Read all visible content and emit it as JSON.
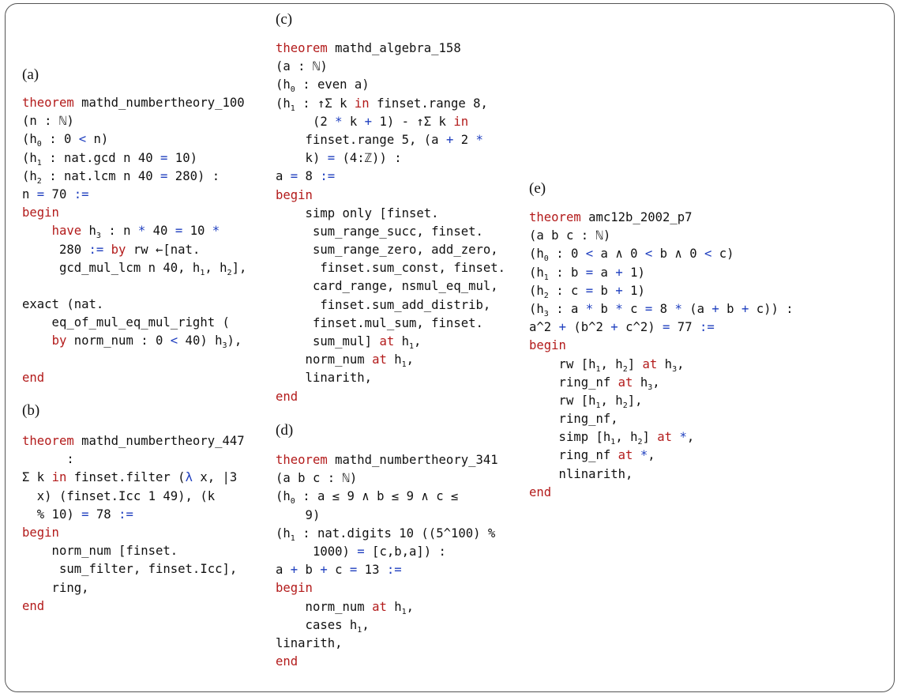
{
  "panels": [
    {
      "label": "(a)",
      "lines": [
        [
          [
            "kw",
            "theorem"
          ],
          [
            "t",
            " mathd_numbertheory_100"
          ]
        ],
        [
          [
            "t",
            "(n : ℕ)"
          ]
        ],
        [
          [
            "t",
            "(h"
          ],
          [
            "s",
            "0"
          ],
          [
            "t",
            " : 0 "
          ],
          [
            "op",
            "<"
          ],
          [
            "t",
            " n)"
          ]
        ],
        [
          [
            "t",
            "(h"
          ],
          [
            "s",
            "1"
          ],
          [
            "t",
            " : nat.gcd n 40 "
          ],
          [
            "op",
            "="
          ],
          [
            "t",
            " 10)"
          ]
        ],
        [
          [
            "t",
            "(h"
          ],
          [
            "s",
            "2"
          ],
          [
            "t",
            " : nat.lcm n 40 "
          ],
          [
            "op",
            "="
          ],
          [
            "t",
            " 280) :"
          ]
        ],
        [
          [
            "t",
            "n "
          ],
          [
            "op",
            "="
          ],
          [
            "t",
            " 70 "
          ],
          [
            "op",
            ":="
          ]
        ],
        [
          [
            "kw",
            "begin"
          ]
        ],
        [
          [
            "t",
            "    "
          ],
          [
            "kw",
            "have"
          ],
          [
            "t",
            " h"
          ],
          [
            "s",
            "3"
          ],
          [
            "t",
            " : n "
          ],
          [
            "op",
            "*"
          ],
          [
            "t",
            " 40 "
          ],
          [
            "op",
            "="
          ],
          [
            "t",
            " 10 "
          ],
          [
            "op",
            "*"
          ]
        ],
        [
          [
            "t",
            "     280 "
          ],
          [
            "op",
            ":="
          ],
          [
            "t",
            " "
          ],
          [
            "kw",
            "by"
          ],
          [
            "t",
            " rw ←[nat."
          ]
        ],
        [
          [
            "t",
            "     gcd_mul_lcm n 40, h"
          ],
          [
            "s",
            "1"
          ],
          [
            "t",
            ", h"
          ],
          [
            "s",
            "2"
          ],
          [
            "t",
            "],"
          ]
        ],
        [],
        [
          [
            "t",
            "exact (nat."
          ]
        ],
        [
          [
            "t",
            "    eq_of_mul_eq_mul_right ("
          ]
        ],
        [
          [
            "t",
            "    "
          ],
          [
            "kw",
            "by"
          ],
          [
            "t",
            " norm_num : 0 "
          ],
          [
            "op",
            "<"
          ],
          [
            "t",
            " 40) h"
          ],
          [
            "s",
            "3"
          ],
          [
            "t",
            "),"
          ]
        ],
        [],
        [
          [
            "kw",
            "end"
          ]
        ]
      ]
    },
    {
      "label": "(b)",
      "lines": [
        [
          [
            "kw",
            "theorem"
          ],
          [
            "t",
            " mathd_numbertheory_447"
          ]
        ],
        [
          [
            "t",
            "      :"
          ]
        ],
        [
          [
            "t",
            "Σ k "
          ],
          [
            "kw",
            "in"
          ],
          [
            "t",
            " finset.filter ("
          ],
          [
            "op",
            "λ"
          ],
          [
            "t",
            " x, |3"
          ]
        ],
        [
          [
            "t",
            "  x) (finset.Icc 1 49), (k"
          ]
        ],
        [
          [
            "t",
            "  % 10) "
          ],
          [
            "op",
            "="
          ],
          [
            "t",
            " 78 "
          ],
          [
            "op",
            ":="
          ]
        ],
        [
          [
            "kw",
            "begin"
          ]
        ],
        [
          [
            "t",
            "    norm_num [finset."
          ]
        ],
        [
          [
            "t",
            "     sum_filter, finset.Icc],"
          ]
        ],
        [
          [
            "t",
            "    ring,"
          ]
        ],
        [
          [
            "kw",
            "end"
          ]
        ]
      ]
    },
    {
      "label": "(c)",
      "lines": [
        [
          [
            "kw",
            "theorem"
          ],
          [
            "t",
            " mathd_algebra_158"
          ]
        ],
        [
          [
            "t",
            "(a : ℕ)"
          ]
        ],
        [
          [
            "t",
            "(h"
          ],
          [
            "s",
            "0"
          ],
          [
            "t",
            " : even a)"
          ]
        ],
        [
          [
            "t",
            "(h"
          ],
          [
            "s",
            "1"
          ],
          [
            "t",
            " : ↑Σ k "
          ],
          [
            "kw",
            "in"
          ],
          [
            "t",
            " finset.range 8,"
          ]
        ],
        [
          [
            "t",
            "     (2 "
          ],
          [
            "op",
            "*"
          ],
          [
            "t",
            " k "
          ],
          [
            "op",
            "+"
          ],
          [
            "t",
            " 1) - ↑Σ k "
          ],
          [
            "kw",
            "in"
          ]
        ],
        [
          [
            "t",
            "    finset.range 5, (a "
          ],
          [
            "op",
            "+"
          ],
          [
            "t",
            " 2 "
          ],
          [
            "op",
            "*"
          ]
        ],
        [
          [
            "t",
            "    k) "
          ],
          [
            "op",
            "="
          ],
          [
            "t",
            " (4:ℤ)) :"
          ]
        ],
        [
          [
            "t",
            "a "
          ],
          [
            "op",
            "="
          ],
          [
            "t",
            " 8 "
          ],
          [
            "op",
            ":="
          ]
        ],
        [
          [
            "kw",
            "begin"
          ]
        ],
        [
          [
            "t",
            "    simp only [finset."
          ]
        ],
        [
          [
            "t",
            "     sum_range_succ, finset."
          ]
        ],
        [
          [
            "t",
            "     sum_range_zero, add_zero,"
          ]
        ],
        [
          [
            "t",
            "      finset.sum_const, finset."
          ]
        ],
        [
          [
            "t",
            "     card_range, nsmul_eq_mul,"
          ]
        ],
        [
          [
            "t",
            "      finset.sum_add_distrib,"
          ]
        ],
        [
          [
            "t",
            "     finset.mul_sum, finset."
          ]
        ],
        [
          [
            "t",
            "     sum_mul] "
          ],
          [
            "kw",
            "at"
          ],
          [
            "t",
            " h"
          ],
          [
            "s",
            "1"
          ],
          [
            "t",
            ","
          ]
        ],
        [
          [
            "t",
            "    norm_num "
          ],
          [
            "kw",
            "at"
          ],
          [
            "t",
            " h"
          ],
          [
            "s",
            "1"
          ],
          [
            "t",
            ","
          ]
        ],
        [
          [
            "t",
            "    linarith,"
          ]
        ],
        [
          [
            "kw",
            "end"
          ]
        ]
      ]
    },
    {
      "label": "(d)",
      "lines": [
        [
          [
            "kw",
            "theorem"
          ],
          [
            "t",
            " mathd_numbertheory_341"
          ]
        ],
        [
          [
            "t",
            "(a b c : ℕ)"
          ]
        ],
        [
          [
            "t",
            "(h"
          ],
          [
            "s",
            "0"
          ],
          [
            "t",
            " : a ≤ 9 ∧ b ≤ 9 ∧ c ≤"
          ]
        ],
        [
          [
            "t",
            "    9)"
          ]
        ],
        [
          [
            "t",
            "(h"
          ],
          [
            "s",
            "1"
          ],
          [
            "t",
            " : nat.digits 10 ((5^100) %"
          ]
        ],
        [
          [
            "t",
            "     1000) "
          ],
          [
            "op",
            "="
          ],
          [
            "t",
            " [c,b,a]) :"
          ]
        ],
        [
          [
            "t",
            "a "
          ],
          [
            "op",
            "+"
          ],
          [
            "t",
            " b "
          ],
          [
            "op",
            "+"
          ],
          [
            "t",
            " c "
          ],
          [
            "op",
            "="
          ],
          [
            "t",
            " 13 "
          ],
          [
            "op",
            ":="
          ]
        ],
        [
          [
            "kw",
            "begin"
          ]
        ],
        [
          [
            "t",
            "    norm_num "
          ],
          [
            "kw",
            "at"
          ],
          [
            "t",
            " h"
          ],
          [
            "s",
            "1"
          ],
          [
            "t",
            ","
          ]
        ],
        [
          [
            "t",
            "    cases h"
          ],
          [
            "s",
            "1"
          ],
          [
            "t",
            ","
          ]
        ],
        [
          [
            "t",
            "linarith,"
          ]
        ],
        [
          [
            "kw",
            "end"
          ]
        ]
      ]
    },
    {
      "label": "(e)",
      "lines": [
        [
          [
            "kw",
            "theorem"
          ],
          [
            "t",
            " amc12b_2002_p7"
          ]
        ],
        [
          [
            "t",
            "(a b c : ℕ)"
          ]
        ],
        [
          [
            "t",
            "(h"
          ],
          [
            "s",
            "0"
          ],
          [
            "t",
            " : 0 "
          ],
          [
            "op",
            "<"
          ],
          [
            "t",
            " a ∧ 0 "
          ],
          [
            "op",
            "<"
          ],
          [
            "t",
            " b ∧ 0 "
          ],
          [
            "op",
            "<"
          ],
          [
            "t",
            " c)"
          ]
        ],
        [
          [
            "t",
            "(h"
          ],
          [
            "s",
            "1"
          ],
          [
            "t",
            " : b "
          ],
          [
            "op",
            "="
          ],
          [
            "t",
            " a "
          ],
          [
            "op",
            "+"
          ],
          [
            "t",
            " 1)"
          ]
        ],
        [
          [
            "t",
            "(h"
          ],
          [
            "s",
            "2"
          ],
          [
            "t",
            " : c "
          ],
          [
            "op",
            "="
          ],
          [
            "t",
            " b "
          ],
          [
            "op",
            "+"
          ],
          [
            "t",
            " 1)"
          ]
        ],
        [
          [
            "t",
            "(h"
          ],
          [
            "s",
            "3"
          ],
          [
            "t",
            " : a "
          ],
          [
            "op",
            "*"
          ],
          [
            "t",
            " b "
          ],
          [
            "op",
            "*"
          ],
          [
            "t",
            " c "
          ],
          [
            "op",
            "="
          ],
          [
            "t",
            " 8 "
          ],
          [
            "op",
            "*"
          ],
          [
            "t",
            " (a "
          ],
          [
            "op",
            "+"
          ],
          [
            "t",
            " b "
          ],
          [
            "op",
            "+"
          ],
          [
            "t",
            " c)) :"
          ]
        ],
        [
          [
            "t",
            "a^2 "
          ],
          [
            "op",
            "+"
          ],
          [
            "t",
            " (b^2 "
          ],
          [
            "op",
            "+"
          ],
          [
            "t",
            " c^2) "
          ],
          [
            "op",
            "="
          ],
          [
            "t",
            " 77 "
          ],
          [
            "op",
            ":="
          ]
        ],
        [
          [
            "kw",
            "begin"
          ]
        ],
        [
          [
            "t",
            "    rw [h"
          ],
          [
            "s",
            "1"
          ],
          [
            "t",
            ", h"
          ],
          [
            "s",
            "2"
          ],
          [
            "t",
            "] "
          ],
          [
            "kw",
            "at"
          ],
          [
            "t",
            " h"
          ],
          [
            "s",
            "3"
          ],
          [
            "t",
            ","
          ]
        ],
        [
          [
            "t",
            "    ring_nf "
          ],
          [
            "kw",
            "at"
          ],
          [
            "t",
            " h"
          ],
          [
            "s",
            "3"
          ],
          [
            "t",
            ","
          ]
        ],
        [
          [
            "t",
            "    rw [h"
          ],
          [
            "s",
            "1"
          ],
          [
            "t",
            ", h"
          ],
          [
            "s",
            "2"
          ],
          [
            "t",
            "],"
          ]
        ],
        [
          [
            "t",
            "    ring_nf,"
          ]
        ],
        [
          [
            "t",
            "    simp [h"
          ],
          [
            "s",
            "1"
          ],
          [
            "t",
            ", h"
          ],
          [
            "s",
            "2"
          ],
          [
            "t",
            "] "
          ],
          [
            "kw",
            "at"
          ],
          [
            "t",
            " "
          ],
          [
            "op",
            "*"
          ],
          [
            "t",
            ","
          ]
        ],
        [
          [
            "t",
            "    ring_nf "
          ],
          [
            "kw",
            "at"
          ],
          [
            "t",
            " "
          ],
          [
            "op",
            "*"
          ],
          [
            "t",
            ","
          ]
        ],
        [
          [
            "t",
            "    nlinarith,"
          ]
        ],
        [
          [
            "kw",
            "end"
          ]
        ]
      ]
    }
  ]
}
